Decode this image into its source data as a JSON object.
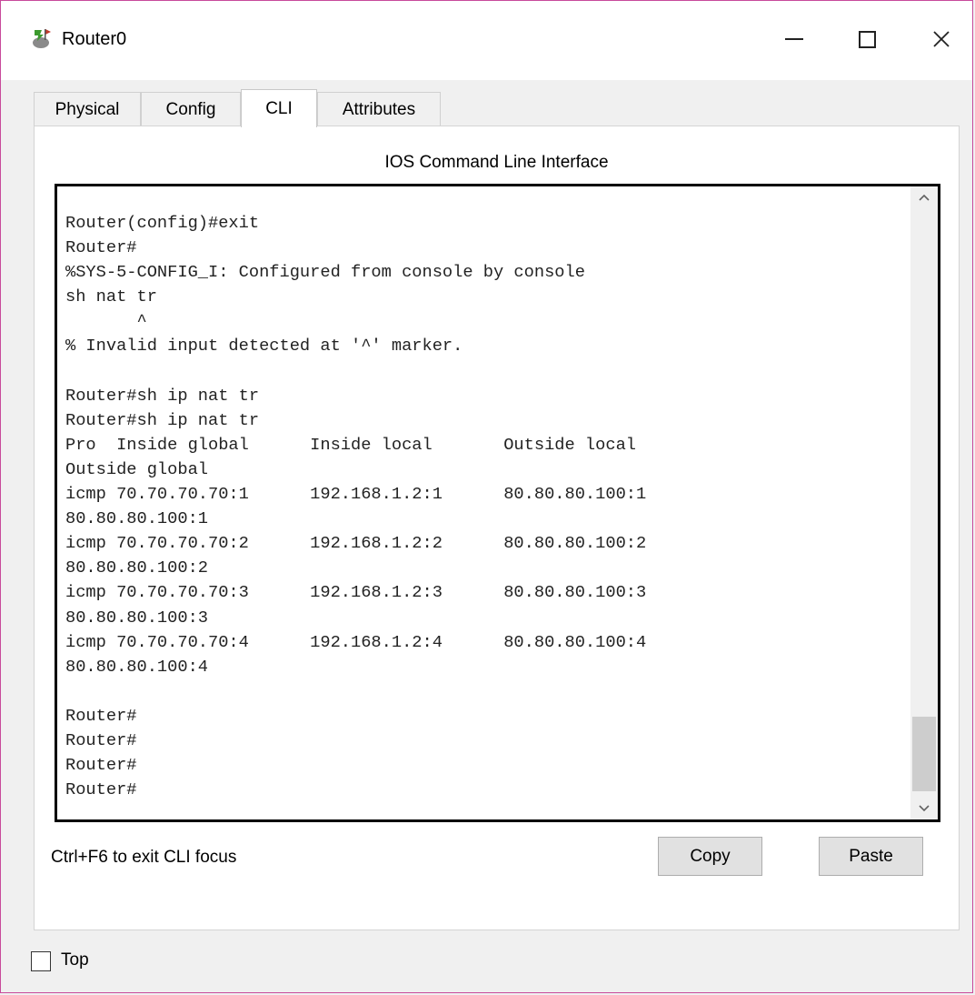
{
  "window": {
    "title": "Router0"
  },
  "icons": {
    "app": "router-icon",
    "minimize": "minimize-icon",
    "maximize": "maximize-icon",
    "close": "close-icon",
    "scroll_up": "chevron-up-icon",
    "scroll_down": "chevron-down-icon"
  },
  "tabs": [
    {
      "label": "Physical",
      "active": false
    },
    {
      "label": "Config",
      "active": false
    },
    {
      "label": "CLI",
      "active": true
    },
    {
      "label": "Attributes",
      "active": false
    }
  ],
  "cli": {
    "heading": "IOS Command Line Interface",
    "lines": [
      "Router(config)#exit",
      "Router#",
      "%SYS-5-CONFIG_I: Configured from console by console",
      "sh nat tr",
      "       ^",
      "% Invalid input detected at '^' marker.",
      "",
      "Router#sh ip nat tr",
      "Router#sh ip nat tr",
      "Pro  Inside global      Inside local       Outside local",
      "Outside global",
      "icmp 70.70.70.70:1      192.168.1.2:1      80.80.80.100:1",
      "80.80.80.100:1",
      "icmp 70.70.70.70:2      192.168.1.2:2      80.80.80.100:2",
      "80.80.80.100:2",
      "icmp 70.70.70.70:3      192.168.1.2:3      80.80.80.100:3",
      "80.80.80.100:3",
      "icmp 70.70.70.70:4      192.168.1.2:4      80.80.80.100:4",
      "80.80.80.100:4",
      "",
      "Router#",
      "Router#",
      "Router#",
      "Router#"
    ],
    "hint": "Ctrl+F6 to exit CLI focus",
    "copy_label": "Copy",
    "paste_label": "Paste"
  },
  "footer": {
    "top_label": "Top",
    "top_checked": false
  },
  "colors": {
    "window_border": "#c84a9b",
    "button_bg": "#e1e1e1"
  }
}
